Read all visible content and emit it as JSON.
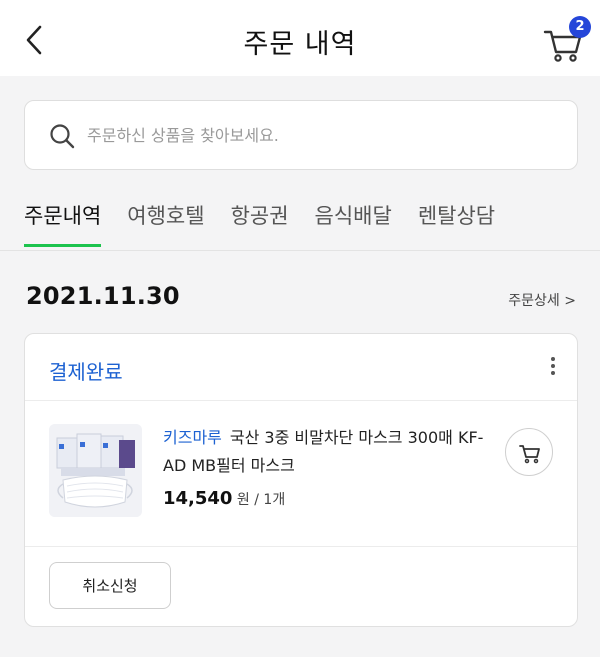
{
  "header": {
    "title": "주문 내역",
    "cart_count": "2"
  },
  "search": {
    "placeholder": "주문하신 상품을 찾아보세요."
  },
  "tabs": [
    {
      "label": "주문내역",
      "active": true
    },
    {
      "label": "여행호텔",
      "active": false
    },
    {
      "label": "항공권",
      "active": false
    },
    {
      "label": "음식배달",
      "active": false
    },
    {
      "label": "렌탈상담",
      "active": false
    }
  ],
  "order": {
    "date": "2021.11.30",
    "detail_link": "주문상세 >",
    "status": "결제완료",
    "item": {
      "brand": "키즈마루",
      "name": "국산 3중 비말차단 마스크 300매 KF-AD MB필터 마스크",
      "price": "14,540",
      "price_suffix": " 원 / 1개"
    },
    "cancel_label": "취소신청"
  },
  "colors": {
    "accent_green": "#1cc34d",
    "link_blue": "#1d62d2",
    "badge_blue": "#2546d9"
  }
}
